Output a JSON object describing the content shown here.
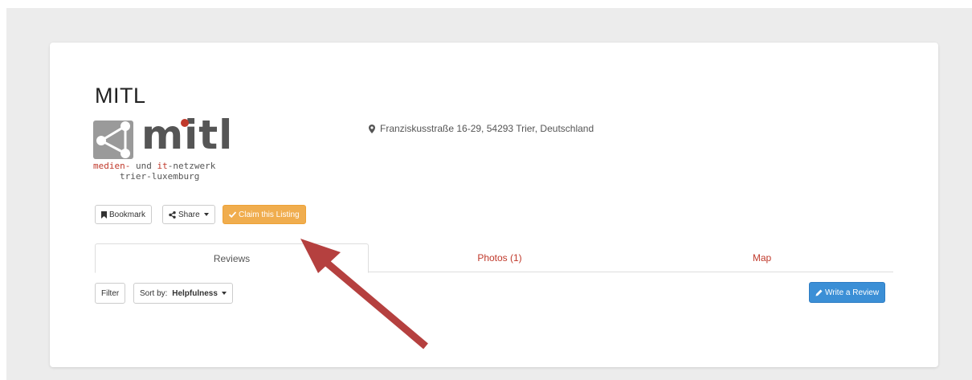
{
  "listing": {
    "title": "MITL",
    "logo": {
      "wordmark": "mitl",
      "tagline_red_1": "medien-",
      "tagline_mid_1": " und ",
      "tagline_red_2": "it",
      "tagline_mid_2": "-netzwerk",
      "tagline_line2": "trier-luxemburg"
    },
    "address": "Franziskusstraße 16-29, 54293 Trier, Deutschland"
  },
  "actions": {
    "bookmark": "Bookmark",
    "share": "Share",
    "claim": "Claim this Listing"
  },
  "tabs": [
    {
      "label": "Reviews",
      "active": true
    },
    {
      "label": "Photos (1)",
      "active": false
    },
    {
      "label": "Map",
      "active": false
    }
  ],
  "reviews_toolbar": {
    "filter": "Filter",
    "sort_prefix": "Sort by: ",
    "sort_value": "Helpfulness",
    "write_review": "Write a Review"
  },
  "colors": {
    "claim_button": "#f0ad4e",
    "write_review_button": "#3b8fd6",
    "tab_link": "#c0392b",
    "annotation_arrow": "#b5403f"
  },
  "icons": {
    "bookmark": "bookmark-icon",
    "share": "share-icon",
    "claim": "check-icon",
    "address": "map-marker-icon",
    "write_review": "pencil-icon"
  }
}
